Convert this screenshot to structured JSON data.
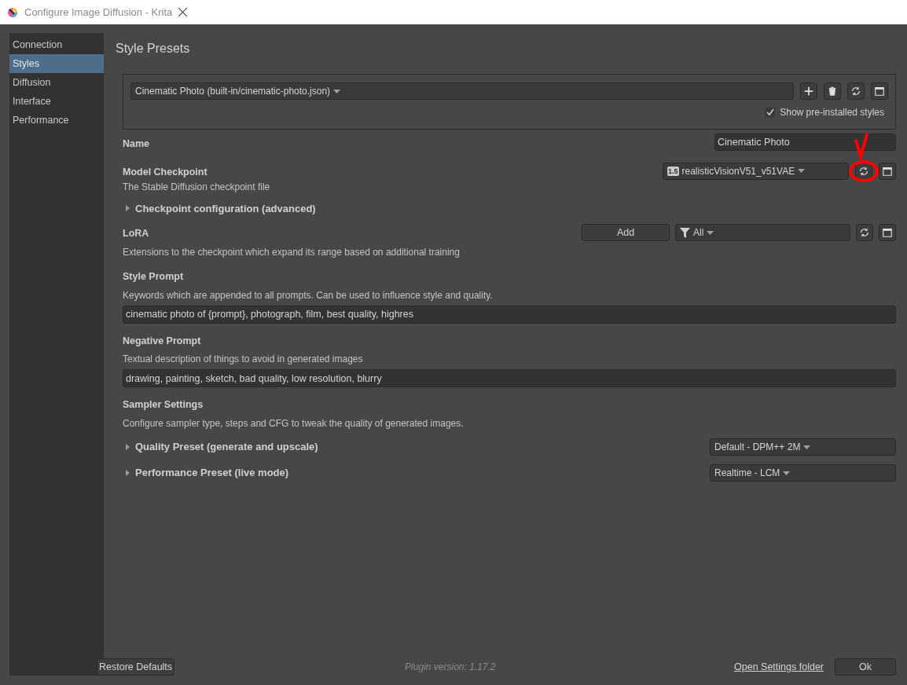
{
  "window": {
    "title": "Configure Image Diffusion - Krita"
  },
  "sidebar": {
    "items": [
      {
        "label": "Connection",
        "selected": false
      },
      {
        "label": "Styles",
        "selected": true
      },
      {
        "label": "Diffusion",
        "selected": false
      },
      {
        "label": "Interface",
        "selected": false
      },
      {
        "label": "Performance",
        "selected": false
      }
    ]
  },
  "heading": "Style Presets",
  "preset": {
    "value": "Cinematic Photo (built-in/cinematic-photo.json)",
    "show_preinstalled": {
      "label": "Show pre-installed styles",
      "checked": true
    }
  },
  "name": {
    "label": "Name",
    "value": "Cinematic Photo"
  },
  "checkpoint": {
    "label": "Model Checkpoint",
    "description": "The Stable Diffusion checkpoint file",
    "badge": "1.5",
    "value": "realisticVisionV51_v51VAE"
  },
  "checkpoint_config": {
    "label": "Checkpoint configuration (advanced)",
    "expanded": false
  },
  "lora": {
    "label": "LoRA",
    "description": "Extensions to the checkpoint which expand its range based on additional training",
    "add_button": "Add",
    "filter": "All"
  },
  "style_prompt": {
    "label": "Style Prompt",
    "description": "Keywords which are appended to all prompts. Can be used to influence style and quality.",
    "value": "cinematic photo of {prompt}, photograph, film, best quality, highres"
  },
  "negative_prompt": {
    "label": "Negative Prompt",
    "description": "Textual description of things to avoid in generated images",
    "value": "drawing, painting, sketch, bad quality, low resolution, blurry"
  },
  "sampler": {
    "label": "Sampler Settings",
    "description": "Configure sampler type, steps and CFG to tweak the quality of generated images.",
    "presets": [
      {
        "label": "Quality Preset (generate and upscale)",
        "expanded": false,
        "value": "Default - DPM++ 2M"
      },
      {
        "label": "Performance Preset (live mode)",
        "expanded": false,
        "value": "Realtime - LCM"
      }
    ]
  },
  "footer": {
    "restore": "Restore Defaults",
    "version": "Plugin version: 1.17.2",
    "link": "Open Settings folder",
    "ok": "Ok"
  }
}
